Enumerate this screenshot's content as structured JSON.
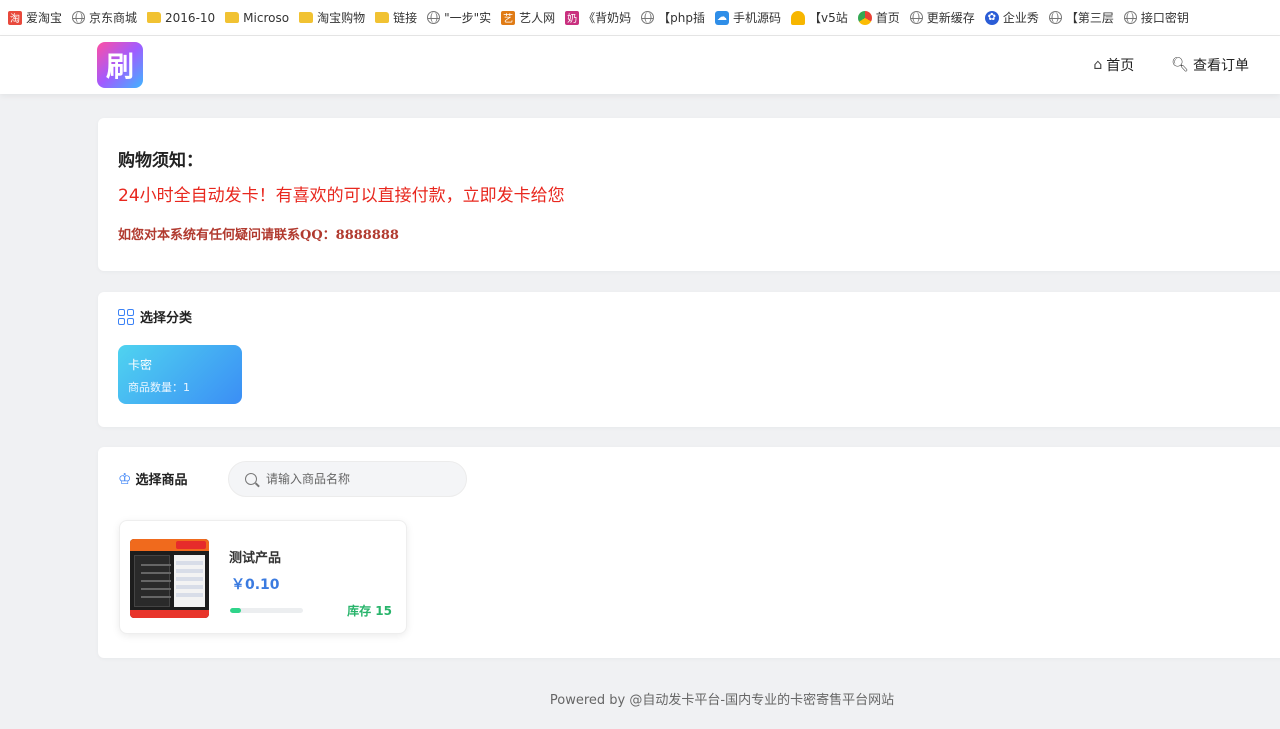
{
  "bookmarks": [
    {
      "label": "爱淘宝",
      "icon": "taobao-icon"
    },
    {
      "label": "京东商城",
      "icon": "globe-icon"
    },
    {
      "label": "2016-10",
      "icon": "folder-icon"
    },
    {
      "label": "Microso",
      "icon": "folder-icon"
    },
    {
      "label": "淘宝购物",
      "icon": "folder-icon"
    },
    {
      "label": "链接",
      "icon": "folder-icon"
    },
    {
      "label": "\"一步\"实",
      "icon": "globe-icon"
    },
    {
      "label": "艺人网",
      "icon": "yiren-icon"
    },
    {
      "label": "《背奶妈",
      "icon": "pink-app-icon"
    },
    {
      "label": "【php插",
      "icon": "globe-icon"
    },
    {
      "label": "手机源码",
      "icon": "cloud-icon"
    },
    {
      "label": "【v5站",
      "icon": "trophy-icon"
    },
    {
      "label": "首页",
      "icon": "colorful-circle-icon"
    },
    {
      "label": "更新缓存",
      "icon": "globe-icon"
    },
    {
      "label": "企业秀",
      "icon": "paw-icon"
    },
    {
      "label": "【第三层",
      "icon": "globe-icon"
    },
    {
      "label": "接口密钥",
      "icon": "globe-icon"
    }
  ],
  "header": {
    "logo_text": "刷",
    "nav": [
      {
        "label": "首页",
        "icon": "home-icon"
      },
      {
        "label": "查看订单",
        "icon": "search-icon"
      }
    ]
  },
  "notice": {
    "title": "购物须知：",
    "main": "24小时全自动发卡！有喜欢的可以直接付款，立即发卡给您",
    "contact": "如您对本系统有任何疑问请联系QQ：8888888"
  },
  "category": {
    "heading": "选择分类",
    "items": [
      {
        "name": "卡密",
        "count_text": "商品数量：1"
      }
    ]
  },
  "products": {
    "heading": "选择商品",
    "search_placeholder": "请输入商品名称",
    "items": [
      {
        "name": "测试产品",
        "price": "￥0.10",
        "stock": "库存 15",
        "stock_fraction": 0.15
      }
    ]
  },
  "footer": {
    "text": "Powered by @自动发卡平台-国内专业的卡密寄售平台网站"
  },
  "colors": {
    "price": "#3b7be0",
    "stock": "#28b46b",
    "notice_red": "#e8271e",
    "category_gradient_start": "#4fd3f0",
    "category_gradient_end": "#3b8ef5"
  }
}
